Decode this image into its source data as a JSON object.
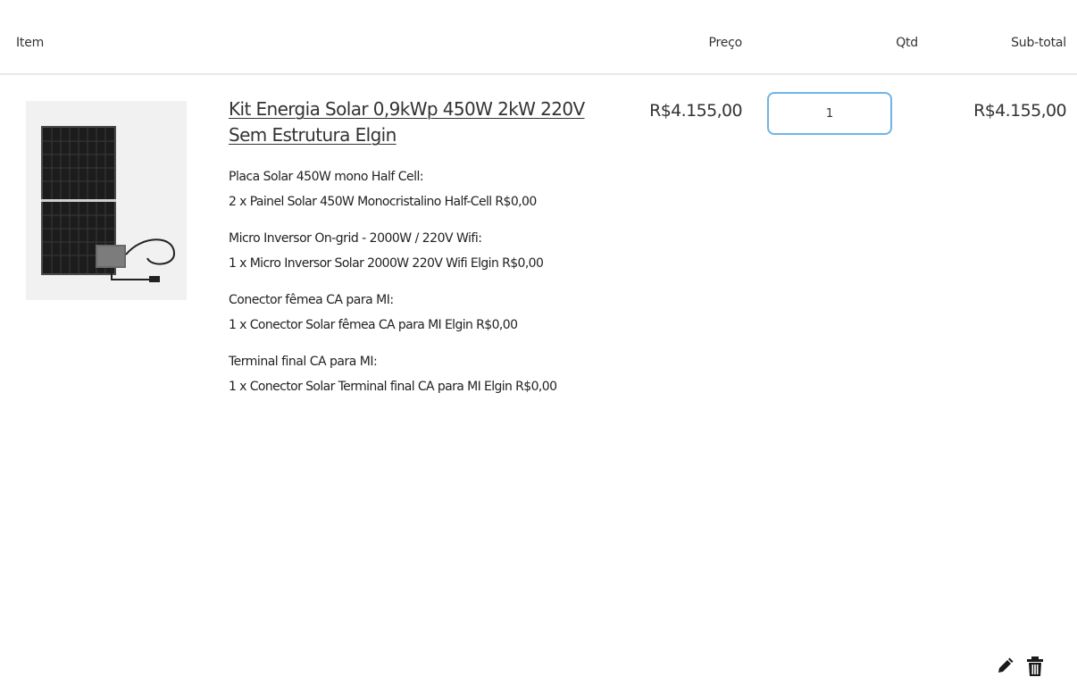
{
  "table_header": {
    "item": "Item",
    "price": "Preço",
    "qty": "Qtd",
    "subtotal": "Sub-total"
  },
  "cart_item": {
    "title": "Kit Energia Solar 0,9kWp 450W 2kW 220V Sem Estrutura Elgin",
    "price": "R$4.155,00",
    "quantity": "1",
    "subtotal": "R$4.155,00",
    "options": [
      {
        "title": "Placa Solar 450W mono Half Cell:",
        "detail": "2 x Painel Solar 450W Monocristalino Half-Cell R$0,00"
      },
      {
        "title": "Micro Inversor On-grid - 2000W / 220V Wifi:",
        "detail": "1 x Micro Inversor Solar 2000W 220V Wifi Elgin R$0,00"
      },
      {
        "title": "Conector fêmea CA para MI:",
        "detail": "1 x Conector Solar fêmea CA para MI Elgin R$0,00"
      },
      {
        "title": "Terminal final CA para MI:",
        "detail": "1 x Conector Solar Terminal final CA para MI Elgin R$0,00"
      }
    ],
    "image_icon": "solar-panel-kit-image",
    "actions": {
      "edit_icon": "pencil-icon",
      "delete_icon": "trash-icon"
    }
  },
  "colors": {
    "qty_border": "#6fb4e6",
    "header_divider": "#e8e8e8",
    "text": "#333333"
  }
}
